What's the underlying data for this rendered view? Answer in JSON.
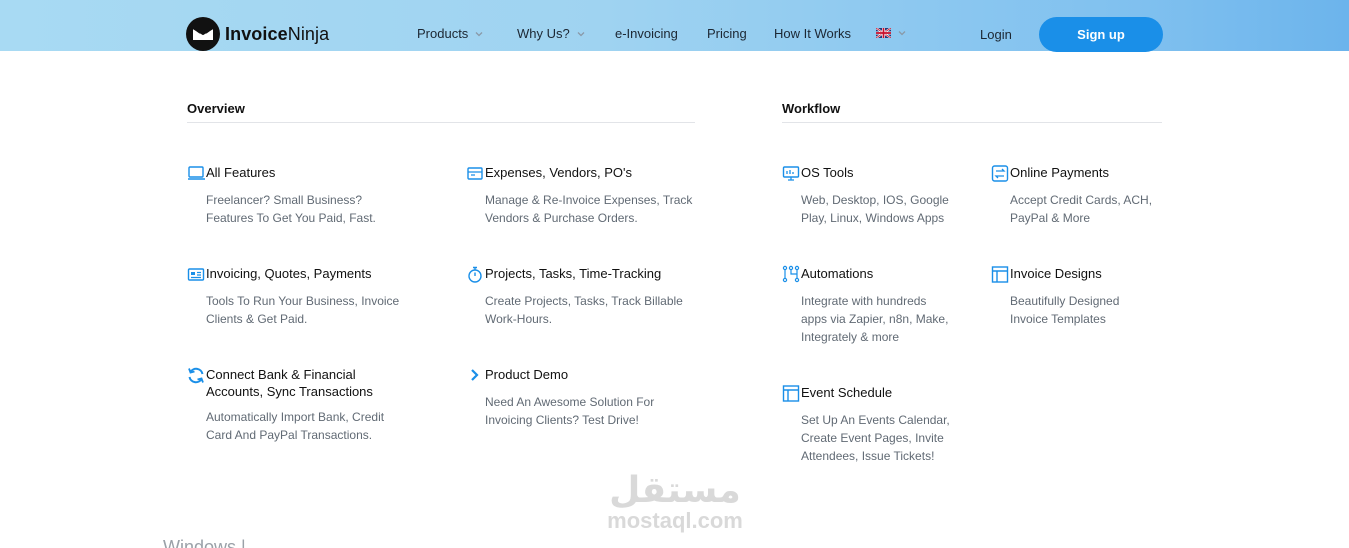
{
  "header": {
    "logo_text_bold": "Invoice",
    "logo_text_regular": "Ninja",
    "nav": [
      {
        "label": "Products",
        "has_chevron": true
      },
      {
        "label": "Why Us?",
        "has_chevron": true
      },
      {
        "label": "e-Invoicing",
        "has_chevron": false
      },
      {
        "label": "Pricing",
        "has_chevron": false
      },
      {
        "label": "How It Works",
        "has_chevron": false
      }
    ],
    "language_icon": "uk-flag-icon",
    "login_label": "Login",
    "signup_label": "Sign up"
  },
  "colors": {
    "accent": "#1a8fe8",
    "header_gradient_start": "#a8daf3",
    "header_gradient_end": "#6cb4ec"
  },
  "overview": {
    "title": "Overview",
    "items": [
      {
        "title": "All Features",
        "desc": [
          "Freelancer? Small Business?",
          "Features To Get You Paid, Fast."
        ],
        "icon": "laptop-icon"
      },
      {
        "title": "Expenses, Vendors, PO's",
        "desc": [
          "Manage & Re-Invoice Expenses, Track",
          "Vendors & Purchase Orders."
        ],
        "icon": "receipt-icon"
      },
      {
        "title": "Invoicing, Quotes, Payments",
        "desc": [
          "Tools To Run Your Business, Invoice",
          "Clients & Get Paid."
        ],
        "icon": "id-card-icon"
      },
      {
        "title": "Projects, Tasks, Time-Tracking",
        "desc": [
          "Create Projects, Tasks, Track Billable",
          "Work-Hours."
        ],
        "icon": "stopwatch-icon"
      },
      {
        "title": [
          "Connect Bank & Financial",
          "Accounts, Sync Transactions"
        ],
        "desc": [
          "Automatically Import Bank, Credit",
          "Card And PayPal Transactions."
        ],
        "icon": "sync-icon"
      },
      {
        "title": "Product Demo",
        "desc": [
          "Need An Awesome Solution For",
          "Invoicing Clients? Test Drive!"
        ],
        "icon": "chevron-right-icon"
      }
    ]
  },
  "workflow": {
    "title": "Workflow",
    "items": [
      {
        "title": "OS Tools",
        "desc": [
          "Web, Desktop, IOS, Google",
          "Play, Linux, Windows Apps"
        ],
        "icon": "monitor-icon"
      },
      {
        "title": "Online Payments",
        "desc": [
          "Accept Credit Cards, ACH,",
          "PayPal & More"
        ],
        "icon": "exchange-icon"
      },
      {
        "title": "Automations",
        "desc": [
          "Integrate with hundreds",
          "apps via Zapier, n8n, Make,",
          "Integrately & more"
        ],
        "icon": "workflow-icon"
      },
      {
        "title": "Invoice Designs",
        "desc": [
          "Beautifully Designed",
          "Invoice Templates"
        ],
        "icon": "layout-icon"
      },
      {
        "title": "Event Schedule",
        "desc": [
          "Set Up An Events Calendar,",
          "Create Event Pages, Invite",
          "Attendees, Issue Tickets!"
        ],
        "icon": "calendar-layout-icon"
      }
    ]
  },
  "watermark": {
    "arabic": "مستقل",
    "latin": "mostaql.com"
  },
  "bottom_partial_text": "Windows | ..."
}
